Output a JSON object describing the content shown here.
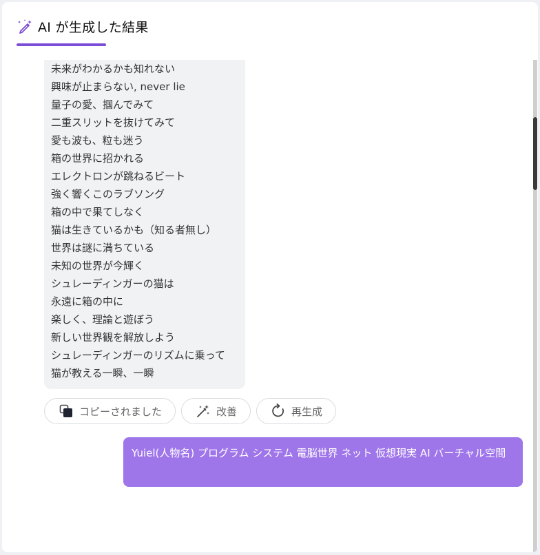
{
  "header": {
    "icon": "magic-pen-icon",
    "title": "AI が生成した結果"
  },
  "ai_response": {
    "lines": [
      "未来がわかるかも知れない",
      "興味が止まらない, never lie",
      "量子の愛、掴んでみて",
      "二重スリットを抜けてみて",
      "愛も波も、粒も迷う",
      "箱の世界に招かれる",
      "エレクトロンが跳ねるビート",
      "強く響くこのラブソング",
      "箱の中で果てしなく",
      "猫は生きているかも（知る者無し）",
      "世界は謎に満ちている",
      "未知の世界が今輝く",
      "シュレーディンガーの猫は",
      "永遠に箱の中に",
      "楽しく、理論と遊ぼう",
      "新しい世界観を解放しよう",
      "シュレーディンガーのリズムに乗って",
      "猫が教える一瞬、一瞬"
    ]
  },
  "actions": {
    "copy": {
      "label": "コピーされました",
      "icon": "copy-icon"
    },
    "improve": {
      "label": "改善",
      "icon": "magic-wand-icon"
    },
    "regenerate": {
      "label": "再生成",
      "icon": "refresh-icon"
    }
  },
  "user_message": {
    "text": "Yuiel(人物名) プログラム システム 電脳世界 ネット 仮想現実 AI バーチャル空間"
  },
  "colors": {
    "accent": "#7c4dd6",
    "user_bubble": "#9f75ea",
    "ai_bubble": "#f1f2f4"
  }
}
